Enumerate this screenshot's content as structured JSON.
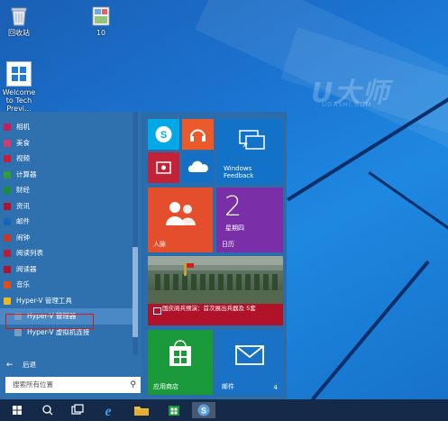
{
  "desktop": {
    "icons": [
      {
        "label": "回收站",
        "icon": "recycle-bin-icon"
      },
      {
        "label": "10",
        "icon": "image-file-icon"
      },
      {
        "label": "Welcome to Tech Previ...",
        "icon": "windows-logo-icon"
      }
    ],
    "watermark": "U大师",
    "watermark_sub": "UDASHI.COM"
  },
  "start_menu": {
    "apps": [
      {
        "label": "相机",
        "color": "#c81d5a",
        "icon": "camera-icon"
      },
      {
        "label": "美食",
        "color": "#d6396b",
        "icon": "food-icon"
      },
      {
        "label": "视频",
        "color": "#c41e3a",
        "icon": "video-icon"
      },
      {
        "label": "计算器",
        "color": "#2e9d3c",
        "icon": "calculator-icon"
      },
      {
        "label": "财经",
        "color": "#1a8c3a",
        "icon": "finance-icon"
      },
      {
        "label": "资讯",
        "color": "#b3122d",
        "icon": "news-icon"
      },
      {
        "label": "邮件",
        "color": "#1466b8",
        "icon": "mail-icon"
      },
      {
        "label": "闹钟",
        "color": "#c0392b",
        "icon": "alarm-icon"
      },
      {
        "label": "阅读列表",
        "color": "#b81d3a",
        "icon": "reading-list-icon"
      },
      {
        "label": "阅读器",
        "color": "#b3122d",
        "icon": "reader-icon"
      },
      {
        "label": "音乐",
        "color": "#e04e16",
        "icon": "music-icon"
      },
      {
        "label": "Hyper-V 管理工具",
        "color": "#e8b923",
        "icon": "folder-icon"
      },
      {
        "label": "Hyper-V 管理器",
        "color": "#7a9cc0",
        "icon": "hyperv-manager-icon",
        "sub": true,
        "selected": true
      },
      {
        "label": "Hyper-V 虚拟机连接",
        "color": "#7a9cc0",
        "icon": "hyperv-vm-connect-icon",
        "sub": true
      }
    ],
    "back_label": "后退",
    "search_placeholder": "搜索所有位置"
  },
  "tiles": {
    "skype": {
      "color": "#00a8e6",
      "icon": "skype-icon"
    },
    "music": {
      "color": "#ec5a2b",
      "icon": "headphones-icon"
    },
    "windows_feedback": {
      "label": "Windows Feedback",
      "color": "#1272c7"
    },
    "video": {
      "color": "#c42237",
      "icon": "video-icon"
    },
    "onedrive": {
      "color": "#1470c5",
      "icon": "onedrive-icon"
    },
    "people": {
      "label": "人脉",
      "color": "#e54e2d"
    },
    "calendar": {
      "day": "2",
      "weekday": "星期四",
      "label": "日历",
      "color": "#7a2fa8"
    },
    "news": {
      "headline": "国庆阅兵预演：首次展出兵器及 5套",
      "color": "#b0122a"
    },
    "store": {
      "label": "应用商店",
      "color": "#1a9a3a"
    },
    "mail": {
      "label": "邮件",
      "count": "4",
      "color": "#1a72c6"
    }
  },
  "taskbar": {
    "items": [
      {
        "icon": "windows-start-icon",
        "active": false
      },
      {
        "icon": "search-icon",
        "active": false
      },
      {
        "icon": "task-view-icon",
        "active": false
      },
      {
        "icon": "internet-explorer-icon",
        "active": false
      },
      {
        "icon": "file-explorer-icon",
        "active": false
      },
      {
        "icon": "store-icon",
        "active": false
      },
      {
        "icon": "speech-app-icon",
        "active": true
      }
    ]
  }
}
